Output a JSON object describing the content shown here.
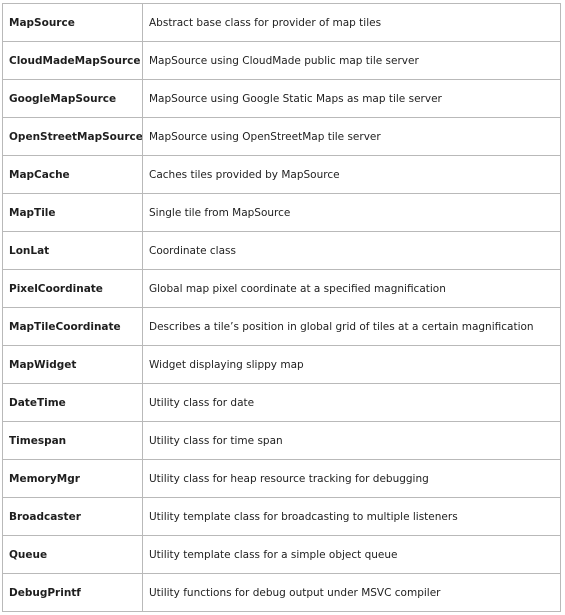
{
  "class_table": {
    "rows": [
      {
        "name": "MapSource",
        "description": "Abstract base class for provider of map tiles"
      },
      {
        "name": "CloudMadeMapSource",
        "description": "MapSource using CloudMade public map tile server"
      },
      {
        "name": "GoogleMapSource",
        "description": "MapSource using Google Static Maps as map tile server"
      },
      {
        "name": "OpenStreetMapSource",
        "description": "MapSource using OpenStreetMap tile server"
      },
      {
        "name": "MapCache",
        "description": "Caches tiles provided by MapSource"
      },
      {
        "name": "MapTile",
        "description": "Single tile from MapSource"
      },
      {
        "name": "LonLat",
        "description": "Coordinate class"
      },
      {
        "name": "PixelCoordinate",
        "description": "Global map pixel coordinate at a specified magnification"
      },
      {
        "name": "MapTileCoordinate",
        "description": "Describes a tile’s position in global grid of tiles at a certain magnification"
      },
      {
        "name": "MapWidget",
        "description": "Widget displaying slippy map"
      },
      {
        "name": "DateTime",
        "description": "Utility class for date"
      },
      {
        "name": "Timespan",
        "description": "Utility class for time span"
      },
      {
        "name": "MemoryMgr",
        "description": "Utility class for heap resource tracking for debugging"
      },
      {
        "name": "Broadcaster",
        "description": "Utility template class for broadcasting to multiple listeners"
      },
      {
        "name": "Queue",
        "description": "Utility template class for a simple object queue"
      },
      {
        "name": "DebugPrintf",
        "description": "Utility functions for debug output under MSVC compiler"
      }
    ]
  }
}
